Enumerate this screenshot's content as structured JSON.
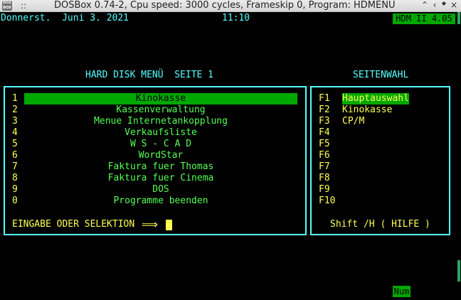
{
  "window": {
    "app_icon_text": "DOS BOX",
    "title": "DOSBox 0.74-2, Cpu speed:      3000 cycles, Frameskip  0, Program:   HDMENU",
    "dots": "::",
    "controls": {
      "keep_above": "⌃",
      "minimize": "‹",
      "restore": "◆",
      "close": "×"
    }
  },
  "header": {
    "date": "Donnerst.  Juni 3. 2021",
    "time": "11:10",
    "version": "HDM II 4.05"
  },
  "main_menu": {
    "title": "HARD DISK MENÜ  SEITE 1",
    "selected_index": 0,
    "items": [
      {
        "key": "1",
        "label": "Kinokasse"
      },
      {
        "key": "2",
        "label": "Kassenverwaltung"
      },
      {
        "key": "3",
        "label": "Menue Internetankopplung"
      },
      {
        "key": "4",
        "label": "Verkaufsliste"
      },
      {
        "key": "5",
        "label": "W S - C A D"
      },
      {
        "key": "6",
        "label": "WordStar"
      },
      {
        "key": "7",
        "label": "Faktura fuer Thomas"
      },
      {
        "key": "8",
        "label": "Faktura fuer Cinema"
      },
      {
        "key": "9",
        "label": "DOS"
      },
      {
        "key": "0",
        "label": "Programme beenden"
      }
    ],
    "prompt": "EINGABE ODER SELEKTION",
    "prompt_arrow": "⟹"
  },
  "page_menu": {
    "title": "SEITENWAHL",
    "selected_index": 0,
    "items": [
      {
        "key": "F1",
        "label": "Hauptauswahl"
      },
      {
        "key": "F2",
        "label": "Kinokasse"
      },
      {
        "key": "F3",
        "label": "CP/M"
      },
      {
        "key": "F4",
        "label": ""
      },
      {
        "key": "F5",
        "label": ""
      },
      {
        "key": "F6",
        "label": ""
      },
      {
        "key": "F7",
        "label": ""
      },
      {
        "key": "F8",
        "label": ""
      },
      {
        "key": "F9",
        "label": ""
      },
      {
        "key": "F10",
        "label": ""
      }
    ],
    "help": "Shift /H ( HILFE )"
  },
  "status": {
    "num_lock": "Num"
  },
  "colors": {
    "screen": "#000000",
    "cyan": "#55ffff",
    "yellow": "#ffff55",
    "green": "#55ff55",
    "highlight": "#00a800"
  }
}
